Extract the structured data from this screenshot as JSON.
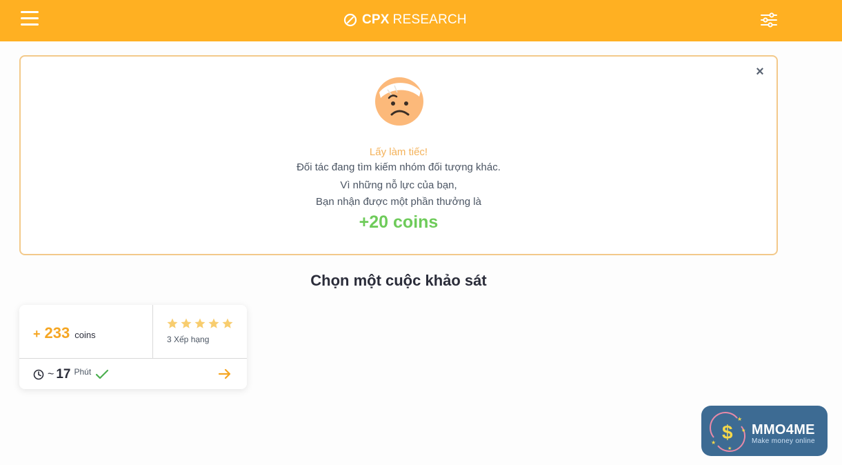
{
  "header": {
    "brand_bold": "CPX",
    "brand_rest": "RESEARCH",
    "menu_icon": "hamburger-icon",
    "filter_icon": "sliders-icon",
    "bar_color": "#ffb022"
  },
  "notice": {
    "close_label": "×",
    "emoji_icon": "sad-bandaged-face-icon",
    "sorry": "Lấy làm tiếc!",
    "line1": "Đối tác đang tìm kiếm nhóm đối tượng khác.",
    "line2": "Vì những nỗ lực của bạn,",
    "line3": "Bạn nhận được một phần thưởng là",
    "reward": "+20 coins"
  },
  "main": {
    "section_title": "Chọn một cuộc khảo sát"
  },
  "survey_card": {
    "plus": "+",
    "amount": "233",
    "unit": "coins",
    "stars": 5,
    "rating_label": "3 Xếp hạng",
    "tilde": "~",
    "minutes": "17",
    "minutes_unit": "Phút",
    "clock_icon": "clock-icon",
    "check_icon": "check-icon",
    "arrow_icon": "arrow-right-icon"
  },
  "watermark": {
    "title": "MMO4ME",
    "subtitle": "Make money online"
  }
}
